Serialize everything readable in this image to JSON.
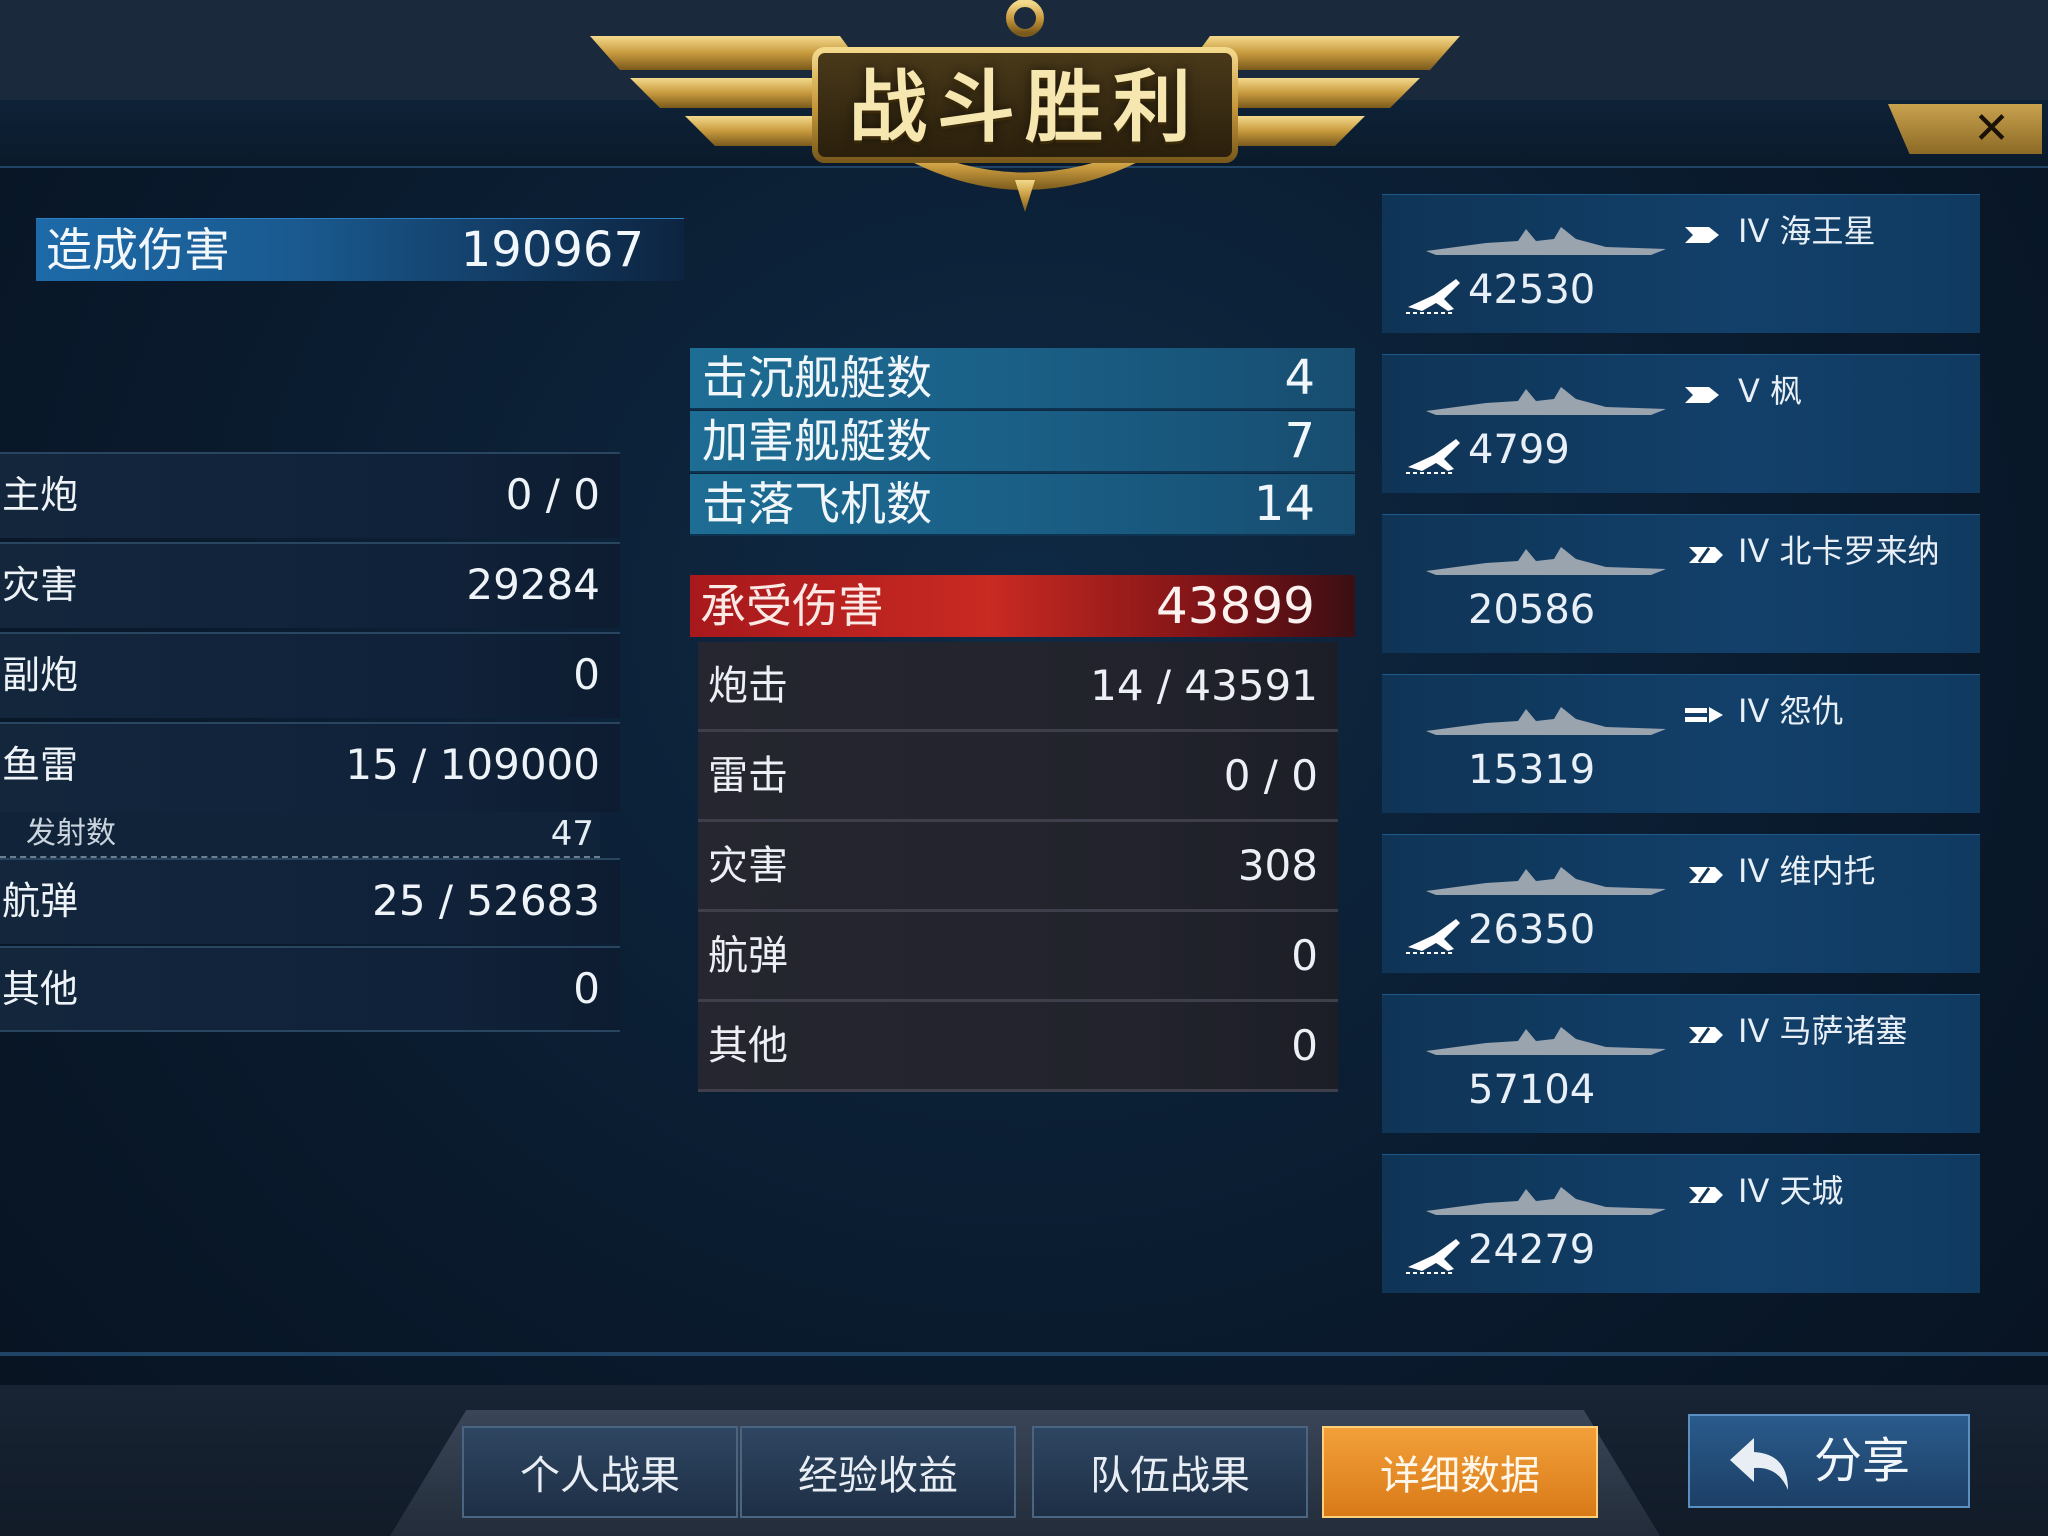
{
  "header": {
    "title": "战斗胜利",
    "close_label": "✕"
  },
  "damage_dealt": {
    "label": "造成伤害",
    "value": "190967"
  },
  "damage_breakdown": [
    {
      "label": "主炮",
      "value": "0 / 0"
    },
    {
      "label": "灾害",
      "value": "29284"
    },
    {
      "label": "副炮",
      "value": "0"
    },
    {
      "label": "鱼雷",
      "value": "15 / 109000"
    }
  ],
  "torpedo_launched": {
    "label": "发射数",
    "value": "47"
  },
  "damage_breakdown2": [
    {
      "label": "航弹",
      "value": "25 / 52683"
    },
    {
      "label": "其他",
      "value": "0"
    }
  ],
  "kills": [
    {
      "label": "击沉舰艇数",
      "value": "4"
    },
    {
      "label": "加害舰艇数",
      "value": "7"
    },
    {
      "label": "击落飞机数",
      "value": "14"
    }
  ],
  "damage_received": {
    "label": "承受伤害",
    "value": "43899"
  },
  "received_breakdown": [
    {
      "label": "炮击",
      "value": "14 / 43591"
    },
    {
      "label": "雷击",
      "value": "0 / 0"
    },
    {
      "label": "灾害",
      "value": "308"
    },
    {
      "label": "航弹",
      "value": "0"
    },
    {
      "label": "其他",
      "value": "0"
    }
  ],
  "ships": [
    {
      "tier": "IV",
      "name": "海王星",
      "damage": "42530",
      "has_plane": true,
      "type": "destroyer-icon"
    },
    {
      "tier": "V",
      "name": "枫",
      "damage": "4799",
      "has_plane": true,
      "type": "destroyer-icon"
    },
    {
      "tier": "IV",
      "name": "北卡罗来纳",
      "damage": "20586",
      "has_plane": false,
      "type": "cruiser-icon"
    },
    {
      "tier": "IV",
      "name": "怨仇",
      "damage": "15319",
      "has_plane": false,
      "type": "carrier-icon"
    },
    {
      "tier": "IV",
      "name": "维内托",
      "damage": "26350",
      "has_plane": true,
      "type": "cruiser-icon"
    },
    {
      "tier": "IV",
      "name": "马萨诸塞",
      "damage": "57104",
      "has_plane": false,
      "type": "cruiser-icon"
    },
    {
      "tier": "IV",
      "name": "天城",
      "damage": "24279",
      "has_plane": true,
      "type": "cruiser-icon"
    }
  ],
  "tabs": [
    {
      "label": "个人战果",
      "active": false
    },
    {
      "label": "经验收益",
      "active": false
    },
    {
      "label": "队伍战果",
      "active": false
    },
    {
      "label": "详细数据",
      "active": true
    }
  ],
  "share": {
    "label": "分享"
  },
  "colors": {
    "accent_orange": "#e8901f",
    "damage_red": "#c92a22",
    "panel_blue": "#1d6aa8",
    "gold": "#c9a24e"
  }
}
